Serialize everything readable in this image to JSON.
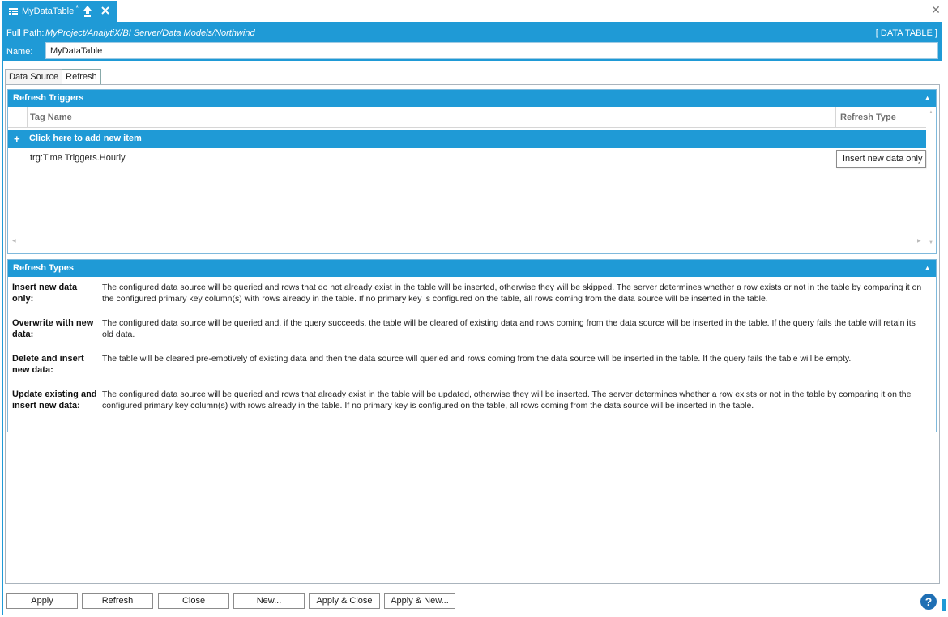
{
  "document_tab": {
    "title": "MyDataTable",
    "dirty_marker": "*",
    "pin_icon": "pin-icon",
    "close_icon": "close-icon"
  },
  "window": {
    "close_glyph": "✕"
  },
  "header": {
    "path_label": "Full Path:",
    "path_value": "MyProject/AnalytiX/BI Server/Data Models/Northwind",
    "type_tag": "[ DATA TABLE ]",
    "name_label": "Name:",
    "name_value": "MyDataTable"
  },
  "tabs": [
    {
      "label": "Data Source",
      "active": false
    },
    {
      "label": "Refresh",
      "active": true
    }
  ],
  "refresh_triggers": {
    "title": "Refresh Triggers",
    "columns": [
      "Tag Name",
      "Refresh Type"
    ],
    "add_item_label": "Click here to add new item",
    "rows": [
      {
        "tag_name": "trg:Time Triggers.Hourly",
        "refresh_type": "Insert new data only"
      }
    ]
  },
  "refresh_types": {
    "title": "Refresh Types",
    "items": [
      {
        "label": "Insert new data only:",
        "description": "The configured data source will be queried and rows that do not already exist in the table will be inserted, otherwise they will be skipped. The server determines whether a row exists or not in the table by comparing it on the configured primary key column(s) with rows already in the table. If no primary key is configured on the table, all rows coming from the data source will be inserted in the table."
      },
      {
        "label": "Overwrite with new data:",
        "description": "The configured data source will be queried and, if the query succeeds, the table will be cleared of existing data and rows coming from the data source will be inserted in the table. If the query fails the table will retain its old data."
      },
      {
        "label": "Delete and insert new data:",
        "description": "The table will be cleared pre-emptively of existing data and then the data source will queried and rows coming from the data source will be inserted in the table. If the query fails the table will be empty."
      },
      {
        "label": "Update existing and insert new data:",
        "description": "The configured data source will be queried and rows that already exist in the table will be updated, otherwise they will be inserted. The server determines whether a row exists or not in the table by comparing it on the configured primary key column(s) with rows already in the table. If no primary key is configured on the table, all rows coming from the data source will be inserted in the table."
      }
    ]
  },
  "buttons": {
    "apply": "Apply",
    "refresh": "Refresh",
    "close": "Close",
    "new": "New...",
    "apply_close": "Apply & Close",
    "apply_new": "Apply & New...",
    "help": "?"
  },
  "colors": {
    "accent": "#1f9ad6",
    "help": "#1f6fb4"
  }
}
